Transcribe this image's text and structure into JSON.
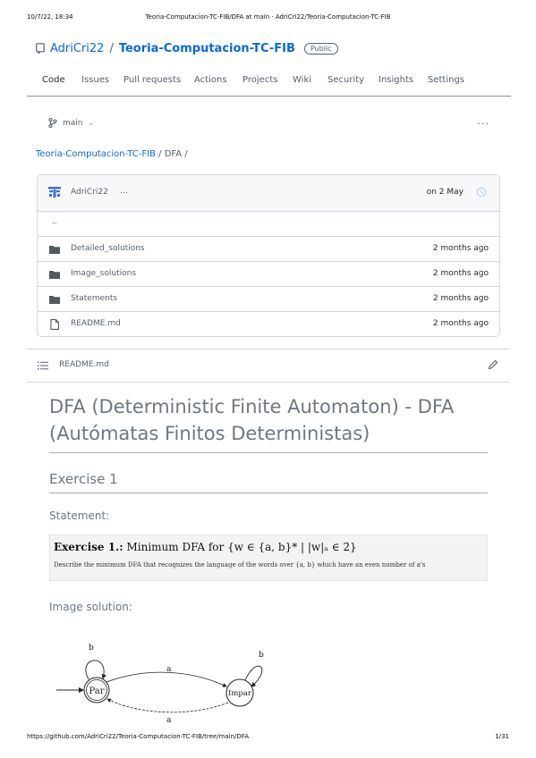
{
  "print_header": {
    "datetime": "10/7/22, 18:34",
    "title": "Teoria-Computacion-TC-FIB/DFA at main · AdriCri22/Teoria-Computacion-TC-FIB"
  },
  "repo": {
    "owner": "AdriCri22",
    "separator": "/",
    "name": "Teoria-Computacion-TC-FIB",
    "visibility": "Public"
  },
  "tabs": [
    "Code",
    "Issues",
    "Pull requests",
    "Actions",
    "Projects",
    "Wiki",
    "Security",
    "Insights",
    "Settings"
  ],
  "branch": {
    "name": "main",
    "dropdown_glyph": "⌄"
  },
  "more_glyph": "···",
  "breadcrumb": {
    "repo": "Teoria-Computacion-TC-FIB",
    "path": " / DFA /"
  },
  "commit": {
    "author": "AdriCri22",
    "ellipsis": "…",
    "date": "on 2 May"
  },
  "files": {
    "parent": "..",
    "items": [
      {
        "name": "Detailed_solutions",
        "type": "folder",
        "time": "2 months ago"
      },
      {
        "name": "Image_solutions",
        "type": "folder",
        "time": "2 months ago"
      },
      {
        "name": "Statements",
        "type": "folder",
        "time": "2 months ago"
      },
      {
        "name": "README.md",
        "type": "file",
        "time": "2 months ago"
      }
    ]
  },
  "readme": {
    "filename": "README.md",
    "h1": "DFA (Deterministic Finite Automaton) - DFA (Autómatas Finitos Deterministas)",
    "exercise_heading": "Exercise 1",
    "statement_label": "Statement:",
    "statement_image": {
      "title_bold": "Exercise 1.:",
      "title_rest": " Minimum DFA for {w ∈ {a, b}* | |w|ₐ ∈ 2̇}",
      "description": "Describe the minimum DFA that recognizes the language of the words over {a, b} which have an even number of a's"
    },
    "image_solution_label": "Image solution:",
    "dfa": {
      "states": [
        "Par",
        "Impar"
      ],
      "labels": {
        "par_loop": "b",
        "impar_loop": "b",
        "top_edge": "a",
        "bottom_edge": "a"
      }
    }
  },
  "print_footer": {
    "url": "https://github.com/AdriCri22/Teoria-Computacion-TC-FIB/tree/main/DFA",
    "page": "1/31"
  },
  "colors": {
    "link": "#0969da",
    "muted": "#57606a",
    "text": "#24292f",
    "heading": "#6e7781",
    "border": "#d0d7de"
  }
}
